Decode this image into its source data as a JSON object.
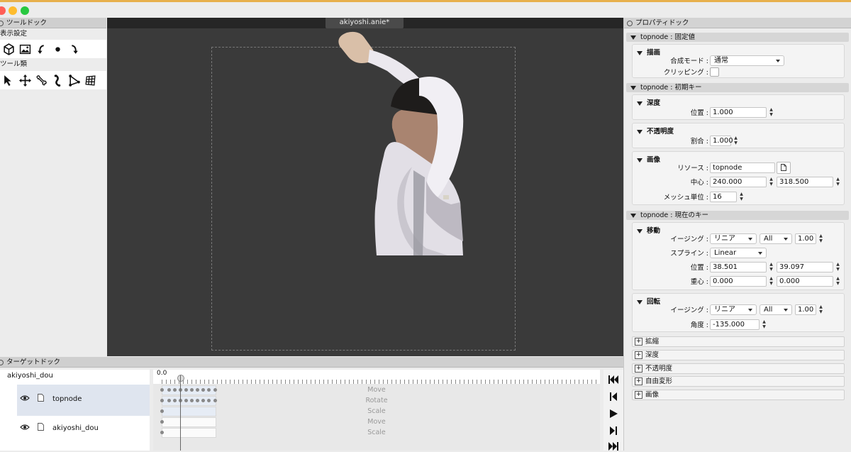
{
  "window": {
    "doc_tab": "akiyoshi.anie*"
  },
  "tool_dock": {
    "title": "ツールドック",
    "display_section": "表示設定",
    "tools_section": "ツール類",
    "display_icons": [
      "cube-icon",
      "image-icon",
      "rotate-left-icon",
      "dot-icon",
      "rotate-right-icon"
    ],
    "tool_icons": [
      "cursor-arrow-icon",
      "move-cross-icon",
      "bone-icon",
      "bone-bend-icon",
      "node-path-icon",
      "mesh-grid-icon"
    ]
  },
  "property_dock": {
    "title": "プロパティドック",
    "fixed": {
      "title": "topnode : 固定値",
      "draw": {
        "title": "描画",
        "blend_label": "合成モード :",
        "blend_value": "通常",
        "clip_label": "クリッピング :",
        "clip_checked": false
      }
    },
    "initial": {
      "title": "topnode : 初期キー",
      "depth": {
        "title": "深度",
        "pos_label": "位置 :",
        "pos_value": "1.000"
      },
      "opacity": {
        "title": "不透明度",
        "rate_label": "割合 :",
        "rate_value": "1.000"
      },
      "image": {
        "title": "画像",
        "resource_label": "リソース :",
        "resource_value": "topnode",
        "center_label": "中心 :",
        "center_x": "240.000",
        "center_y": "318.500",
        "mesh_label": "メッシュ単位 :",
        "mesh_value": "16"
      }
    },
    "current": {
      "title": "topnode : 現在のキー",
      "move": {
        "title": "移動",
        "easing_label": "イージング :",
        "easing_value": "リニア",
        "easing_range": "All",
        "easing_weight": "1.00",
        "spline_label": "スプライン :",
        "spline_value": "Linear",
        "pos_label": "位置 :",
        "pos_x": "38.501",
        "pos_y": "39.097",
        "center_label": "重心 :",
        "center_x": "0.000",
        "center_y": "0.000"
      },
      "rotate": {
        "title": "回転",
        "easing_label": "イージング :",
        "easing_value": "リニア",
        "easing_range": "All",
        "easing_weight": "1.00",
        "angle_label": "角度 :",
        "angle_value": "-135.000"
      },
      "collapsed": [
        "拡縮",
        "深度",
        "不透明度",
        "自由変形",
        "画像"
      ]
    }
  },
  "target_dock": {
    "title": "ターゲットドック",
    "root": "akiyoshi_dou",
    "nodes": [
      "topnode",
      "akiyoshi_dou"
    ],
    "ruler_start": "0.0",
    "track_labels": [
      "Move",
      "Rotate",
      "Scale",
      "Move",
      "Scale"
    ]
  }
}
